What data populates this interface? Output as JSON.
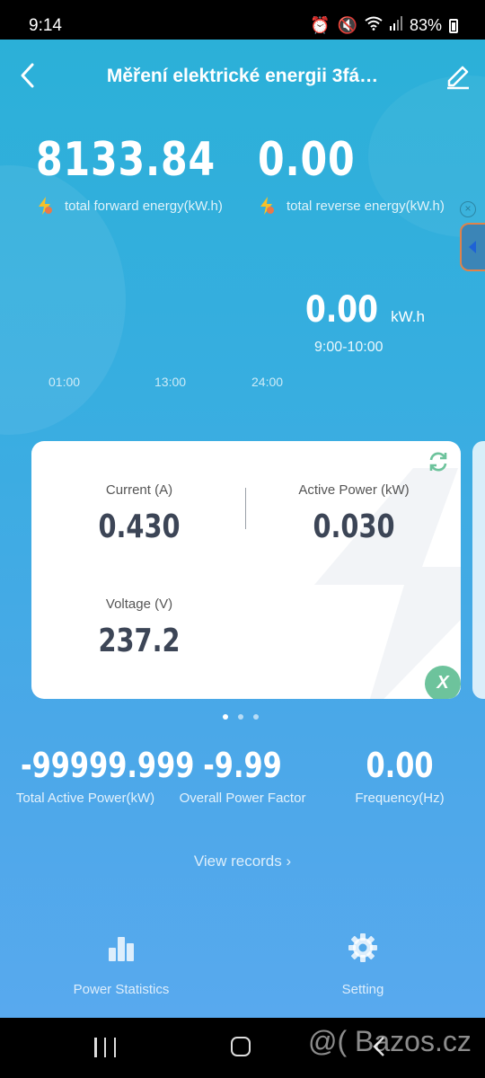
{
  "status_bar": {
    "time": "9:14",
    "battery": "83%"
  },
  "header": {
    "title": "Měření elektrické energii 3fá…"
  },
  "energy": {
    "forward": {
      "value": "8133.84",
      "label": "total forward energy(kW.h)"
    },
    "reverse": {
      "value": "0.00",
      "label": "total reverse energy(kW.h)"
    }
  },
  "usage": {
    "value": "0.00",
    "unit": "kW.h",
    "range": "9:00-10:00"
  },
  "chart_axis": [
    "01:00",
    "13:00",
    "24:00"
  ],
  "card": {
    "current": {
      "label": "Current (A)",
      "value": "0.430"
    },
    "active_power": {
      "label": "Active Power (kW)",
      "value": "0.030"
    },
    "voltage": {
      "label": "Voltage (V)",
      "value": "237.2"
    },
    "x_label": "X"
  },
  "stats": [
    {
      "value": "-99999.999",
      "label": "Total Active Power(kW)"
    },
    {
      "value": "-9.99",
      "label": "Overall Power Factor"
    },
    {
      "value": "0.00",
      "label": "Frequency(Hz)"
    }
  ],
  "view_records": "View records",
  "tabs": {
    "power_statistics": "Power Statistics",
    "setting": "Setting"
  },
  "watermark": "@( Bazos.cz",
  "colors": {
    "accent_green": "#6dc39c",
    "card_value": "#3c4556"
  }
}
